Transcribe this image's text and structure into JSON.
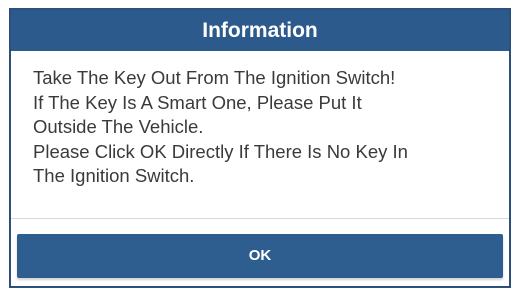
{
  "dialog": {
    "title": "Information",
    "message_lines": [
      "Take The Key Out From The Ignition Switch!",
      "If The Key Is A Smart One, Please Put It",
      "Outside The Vehicle.",
      "Please Click OK Directly If There Is No Key In",
      "The Ignition Switch."
    ],
    "ok_label": "OK"
  },
  "colors": {
    "title_bar": "#2d5a8c",
    "button": "#2e5d90",
    "text": "#3a3a3a",
    "background": "#ffffff"
  }
}
